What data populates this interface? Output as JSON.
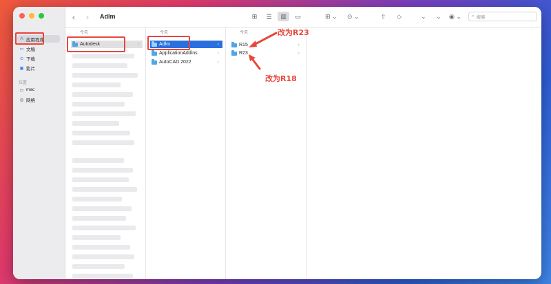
{
  "window": {
    "title": "Adlm"
  },
  "sidebar": {
    "favorites_header": "",
    "items": [
      {
        "label": "应用程序",
        "icon": "apps-icon"
      },
      {
        "label": "文稿",
        "icon": "document-icon"
      },
      {
        "label": "下载",
        "icon": "download-icon"
      },
      {
        "label": "影片",
        "icon": "movie-icon"
      }
    ],
    "locations_header": "位置",
    "locations": [
      {
        "label": "mac",
        "icon": "laptop-icon"
      },
      {
        "label": "网络",
        "icon": "network-icon"
      }
    ]
  },
  "toolbar": {
    "search_placeholder": "搜索"
  },
  "columns": [
    {
      "header": "今天",
      "rows": [
        {
          "label": "Autodesk",
          "selected": "gray"
        }
      ]
    },
    {
      "header": "今天",
      "rows": [
        {
          "label": "Adlm",
          "selected": "blue"
        },
        {
          "label": "ApplicationAddins"
        },
        {
          "label": "AutoCAD 2022"
        }
      ]
    },
    {
      "header": "今天",
      "rows": [
        {
          "label": "R15"
        },
        {
          "label": "R23"
        }
      ]
    }
  ],
  "annotations": {
    "first": "改为R23",
    "second": "改为R18"
  },
  "colors": {
    "accent": "#2a6fe0",
    "annotation": "#e7463c"
  }
}
